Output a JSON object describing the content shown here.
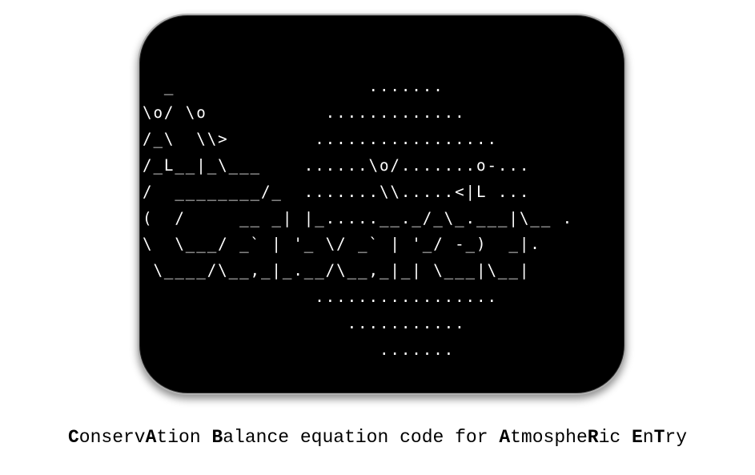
{
  "logo": {
    "ascii_lines": [
      "  _                  .......",
      "\\o/ \\o           .............",
      "/_\\  \\\\>        .................",
      "/_L__|_\\___    ......\\o/.......o-...",
      "/  ________/_  .......\\\\.....<|L ...",
      "(  /     __ _| |_.....__._/_\\_.___|\\__ .",
      "\\  \\___/ _` | '_ \\/ _` | '_/ -_)  _|.",
      " \\____/\\__,_|_.__/\\__,_|_| \\___|\\__|",
      "                .................",
      "                   ...........",
      "                      ......."
    ]
  },
  "caption": {
    "parts": [
      {
        "text": "C",
        "bold": true
      },
      {
        "text": "onserv",
        "bold": false
      },
      {
        "text": "A",
        "bold": true
      },
      {
        "text": "tion ",
        "bold": false
      },
      {
        "text": "B",
        "bold": true
      },
      {
        "text": "alance equation code for ",
        "bold": false
      },
      {
        "text": "A",
        "bold": true
      },
      {
        "text": "tmosphe",
        "bold": false
      },
      {
        "text": "R",
        "bold": true
      },
      {
        "text": "ic ",
        "bold": false
      },
      {
        "text": "E",
        "bold": true
      },
      {
        "text": "n",
        "bold": false
      },
      {
        "text": "T",
        "bold": true
      },
      {
        "text": "ry",
        "bold": false
      }
    ]
  }
}
